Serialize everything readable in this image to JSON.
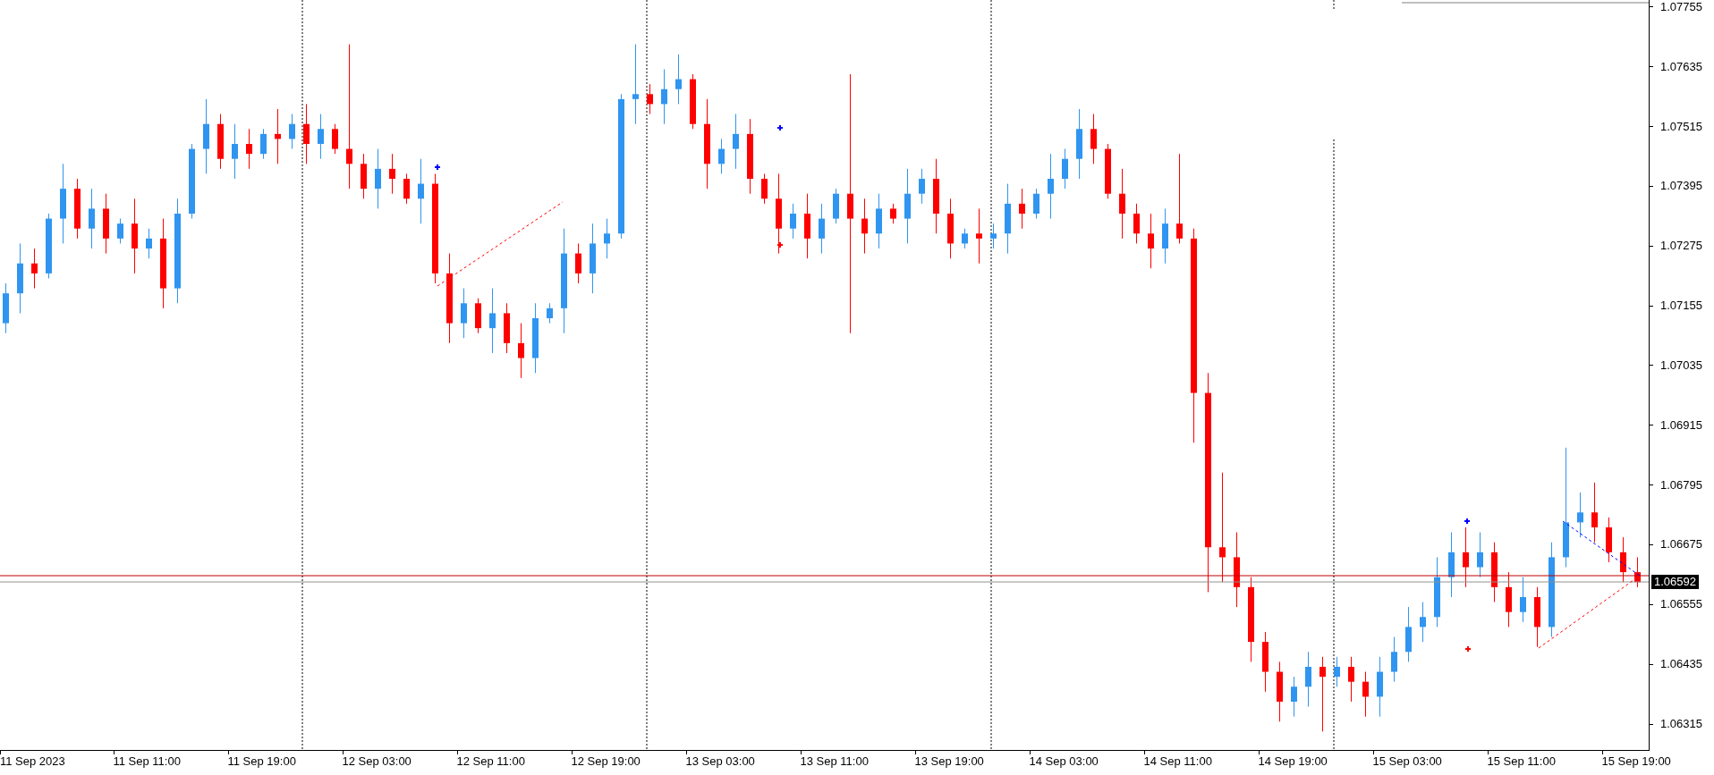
{
  "chart_data": {
    "type": "candlestick",
    "categories": [
      null,
      null,
      "11 Sep 2023",
      null,
      null,
      null,
      null,
      null,
      null,
      null,
      "11 Sep 11:00",
      null,
      null,
      null,
      null,
      null,
      null,
      null,
      "11 Sep 19:00",
      null,
      null,
      null,
      null,
      null,
      null,
      null,
      "12 Sep 03:00",
      null,
      null,
      null,
      null,
      null,
      null,
      null,
      "12 Sep 11:00",
      null,
      null,
      null,
      null,
      null,
      null,
      null,
      "12 Sep 19:00",
      null,
      null,
      null,
      null,
      null,
      null,
      null,
      "13 Sep 03:00",
      null,
      null,
      null,
      null,
      null,
      null,
      null,
      "13 Sep 11:00",
      null,
      null,
      null,
      null,
      null,
      null,
      null,
      "13 Sep 19:00",
      null,
      null,
      null,
      null,
      null,
      null,
      null,
      "14 Sep 03:00",
      null,
      null,
      null,
      null,
      null,
      null,
      null,
      "14 Sep 11:00",
      null,
      null,
      null,
      null,
      null,
      null,
      null,
      "14 Sep 19:00",
      null,
      null,
      null,
      null,
      null,
      null,
      null,
      "15 Sep 03:00",
      null,
      null,
      null,
      null,
      null,
      null,
      null,
      "15 Sep 11:00",
      null,
      null,
      null,
      null,
      null,
      null,
      null,
      "15 Sep 19:00"
    ],
    "ohlc": [
      [
        1.0712,
        1.072,
        1.071,
        1.0718
      ],
      [
        1.0718,
        1.0728,
        1.0714,
        1.0724
      ],
      [
        1.0724,
        1.0727,
        1.0719,
        1.0722
      ],
      [
        1.0722,
        1.0734,
        1.0721,
        1.0733
      ],
      [
        1.0733,
        1.0744,
        1.0728,
        1.0739
      ],
      [
        1.0739,
        1.0741,
        1.0729,
        1.0731
      ],
      [
        1.0731,
        1.0739,
        1.0727,
        1.0735
      ],
      [
        1.0735,
        1.0738,
        1.0726,
        1.0729
      ],
      [
        1.0729,
        1.0733,
        1.0728,
        1.0732
      ],
      [
        1.0732,
        1.0737,
        1.0722,
        1.0727
      ],
      [
        1.0727,
        1.0731,
        1.0725,
        1.0729
      ],
      [
        1.0729,
        1.0733,
        1.0715,
        1.0719
      ],
      [
        1.0719,
        1.0737,
        1.0716,
        1.0734
      ],
      [
        1.0734,
        1.0748,
        1.0733,
        1.0747
      ],
      [
        1.0747,
        1.0757,
        1.0742,
        1.0752
      ],
      [
        1.0752,
        1.0754,
        1.0743,
        1.0745
      ],
      [
        1.0745,
        1.0752,
        1.0741,
        1.0748
      ],
      [
        1.0748,
        1.0751,
        1.0743,
        1.0746
      ],
      [
        1.0746,
        1.0751,
        1.0745,
        1.075
      ],
      [
        1.075,
        1.0755,
        1.0744,
        1.0749
      ],
      [
        1.0749,
        1.0754,
        1.0747,
        1.0752
      ],
      [
        1.0752,
        1.0756,
        1.0744,
        1.0748
      ],
      [
        1.0748,
        1.0754,
        1.0745,
        1.0751
      ],
      [
        1.0751,
        1.0752,
        1.0746,
        1.0747
      ],
      [
        1.0747,
        1.0768,
        1.0739,
        1.0744
      ],
      [
        1.0744,
        1.0746,
        1.0737,
        1.0739
      ],
      [
        1.0739,
        1.0747,
        1.0735,
        1.0743
      ],
      [
        1.0743,
        1.0746,
        1.0738,
        1.0741
      ],
      [
        1.0741,
        1.0742,
        1.0736,
        1.0737
      ],
      [
        1.0737,
        1.0745,
        1.0732,
        1.074
      ],
      [
        1.074,
        1.0742,
        1.072,
        1.0722
      ],
      [
        1.0722,
        1.0726,
        1.0708,
        1.0712
      ],
      [
        1.0712,
        1.0719,
        1.0709,
        1.0716
      ],
      [
        1.0716,
        1.0717,
        1.071,
        1.0711
      ],
      [
        1.0711,
        1.0719,
        1.0706,
        1.0714
      ],
      [
        1.0714,
        1.0716,
        1.0706,
        1.0708
      ],
      [
        1.0708,
        1.0712,
        1.0701,
        1.0705
      ],
      [
        1.0705,
        1.0716,
        1.0702,
        1.0713
      ],
      [
        1.0713,
        1.0716,
        1.0712,
        1.0715
      ],
      [
        1.0715,
        1.0731,
        1.071,
        1.0726
      ],
      [
        1.0726,
        1.0728,
        1.072,
        1.0722
      ],
      [
        1.0722,
        1.0732,
        1.0718,
        1.0728
      ],
      [
        1.0728,
        1.0733,
        1.0725,
        1.073
      ],
      [
        1.073,
        1.0758,
        1.0729,
        1.0757
      ],
      [
        1.0757,
        1.0768,
        1.0752,
        1.0758
      ],
      [
        1.0758,
        1.076,
        1.0754,
        1.0756
      ],
      [
        1.0756,
        1.0763,
        1.0752,
        1.0759
      ],
      [
        1.0759,
        1.0766,
        1.0756,
        1.0761
      ],
      [
        1.0761,
        1.0762,
        1.0751,
        1.0752
      ],
      [
        1.0752,
        1.0757,
        1.0739,
        1.0744
      ],
      [
        1.0744,
        1.0749,
        1.0742,
        1.0747
      ],
      [
        1.0747,
        1.0754,
        1.0743,
        1.075
      ],
      [
        1.075,
        1.0753,
        1.0738,
        1.0741
      ],
      [
        1.0741,
        1.0742,
        1.0736,
        1.0737
      ],
      [
        1.0737,
        1.0742,
        1.0726,
        1.0731
      ],
      [
        1.0731,
        1.0736,
        1.0729,
        1.0734
      ],
      [
        1.0734,
        1.0738,
        1.0725,
        1.0729
      ],
      [
        1.0729,
        1.0736,
        1.0726,
        1.0733
      ],
      [
        1.0733,
        1.0739,
        1.0732,
        1.0738
      ],
      [
        1.0738,
        1.0762,
        1.071,
        1.0733
      ],
      [
        1.0733,
        1.0737,
        1.0726,
        1.073
      ],
      [
        1.073,
        1.0738,
        1.0727,
        1.0735
      ],
      [
        1.0735,
        1.0736,
        1.0732,
        1.0733
      ],
      [
        1.0733,
        1.0743,
        1.0728,
        1.0738
      ],
      [
        1.0738,
        1.0743,
        1.0736,
        1.0741
      ],
      [
        1.0741,
        1.0745,
        1.073,
        1.0734
      ],
      [
        1.0734,
        1.0737,
        1.0725,
        1.0728
      ],
      [
        1.0728,
        1.0731,
        1.0727,
        1.073
      ],
      [
        1.073,
        1.0735,
        1.0724,
        1.0729
      ],
      [
        1.0729,
        1.0732,
        1.0727,
        1.073
      ],
      [
        1.073,
        1.074,
        1.0726,
        1.0736
      ],
      [
        1.0736,
        1.0739,
        1.0731,
        1.0734
      ],
      [
        1.0734,
        1.0739,
        1.0733,
        1.0738
      ],
      [
        1.0738,
        1.0746,
        1.0733,
        1.0741
      ],
      [
        1.0741,
        1.0747,
        1.0739,
        1.0745
      ],
      [
        1.0745,
        1.0755,
        1.0741,
        1.0751
      ],
      [
        1.0751,
        1.0754,
        1.0744,
        1.0747
      ],
      [
        1.0747,
        1.0748,
        1.0737,
        1.0738
      ],
      [
        1.0738,
        1.0743,
        1.0729,
        1.0734
      ],
      [
        1.0734,
        1.0736,
        1.0728,
        1.073
      ],
      [
        1.073,
        1.0734,
        1.0723,
        1.0727
      ],
      [
        1.0727,
        1.0735,
        1.0724,
        1.0732
      ],
      [
        1.0732,
        1.0746,
        1.0728,
        1.0729
      ],
      [
        1.0729,
        1.0731,
        1.0688,
        1.0698
      ],
      [
        1.0698,
        1.0702,
        1.0658,
        1.0667
      ],
      [
        1.0667,
        1.0682,
        1.066,
        1.0665
      ],
      [
        1.0665,
        1.067,
        1.0655,
        1.0659
      ],
      [
        1.0659,
        1.0661,
        1.0644,
        1.0648
      ],
      [
        1.0648,
        1.065,
        1.0638,
        1.0642
      ],
      [
        1.0642,
        1.0644,
        1.0632,
        1.0636
      ],
      [
        1.0636,
        1.0641,
        1.0633,
        1.0639
      ],
      [
        1.0639,
        1.0646,
        1.0635,
        1.0643
      ],
      [
        1.0643,
        1.0645,
        1.063,
        1.0641
      ],
      [
        1.0641,
        1.0645,
        1.0639,
        1.0643
      ],
      [
        1.0643,
        1.0645,
        1.0636,
        1.064
      ],
      [
        1.064,
        1.0642,
        1.0633,
        1.0637
      ],
      [
        1.0637,
        1.0645,
        1.0633,
        1.0642
      ],
      [
        1.0642,
        1.0649,
        1.064,
        1.0646
      ],
      [
        1.0646,
        1.0655,
        1.0644,
        1.0651
      ],
      [
        1.0651,
        1.0656,
        1.0648,
        1.0653
      ],
      [
        1.0653,
        1.0665,
        1.0651,
        1.0661
      ],
      [
        1.0661,
        1.067,
        1.0657,
        1.0666
      ],
      [
        1.0666,
        1.0671,
        1.0659,
        1.0663
      ],
      [
        1.0663,
        1.067,
        1.0661,
        1.0666
      ],
      [
        1.0666,
        1.0668,
        1.0656,
        1.0659
      ],
      [
        1.0659,
        1.0662,
        1.0651,
        1.0654
      ],
      [
        1.0654,
        1.0661,
        1.0652,
        1.0657
      ],
      [
        1.0657,
        1.0659,
        1.0647,
        1.0651
      ],
      [
        1.0651,
        1.0668,
        1.0649,
        1.0665
      ],
      [
        1.0665,
        1.0687,
        1.0663,
        1.0672
      ],
      [
        1.0672,
        1.0678,
        1.0669,
        1.0674
      ],
      [
        1.0674,
        1.068,
        1.0668,
        1.0671
      ],
      [
        1.0671,
        1.0673,
        1.0664,
        1.0666
      ],
      [
        1.0666,
        1.0669,
        1.066,
        1.0662
      ],
      [
        1.0662,
        1.0665,
        1.0659,
        1.066
      ]
    ],
    "ylim": [
      1.06263,
      1.07769
    ],
    "yticks": [
      1.07755,
      1.07635,
      1.07515,
      1.07395,
      1.07275,
      1.07155,
      1.07035,
      1.06915,
      1.06795,
      1.06675,
      1.06555,
      1.06435,
      1.06315
    ]
  },
  "current_price": "1.06592"
}
